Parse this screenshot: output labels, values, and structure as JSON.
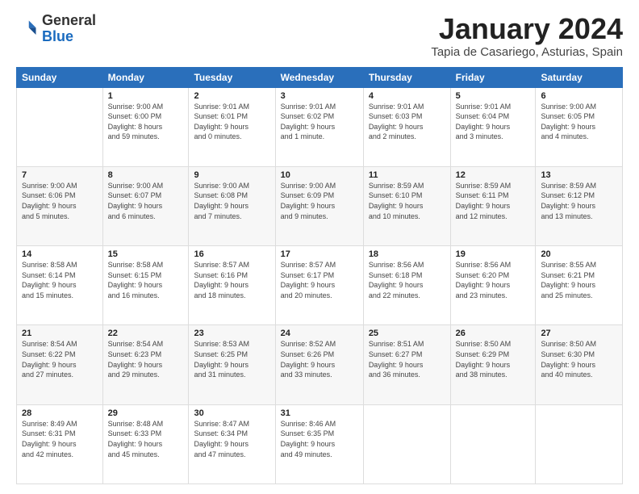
{
  "logo": {
    "general": "General",
    "blue": "Blue"
  },
  "header": {
    "month": "January 2024",
    "location": "Tapia de Casariego, Asturias, Spain"
  },
  "weekdays": [
    "Sunday",
    "Monday",
    "Tuesday",
    "Wednesday",
    "Thursday",
    "Friday",
    "Saturday"
  ],
  "weeks": [
    [
      {
        "day": "",
        "info": ""
      },
      {
        "day": "1",
        "info": "Sunrise: 9:00 AM\nSunset: 6:00 PM\nDaylight: 8 hours\nand 59 minutes."
      },
      {
        "day": "2",
        "info": "Sunrise: 9:01 AM\nSunset: 6:01 PM\nDaylight: 9 hours\nand 0 minutes."
      },
      {
        "day": "3",
        "info": "Sunrise: 9:01 AM\nSunset: 6:02 PM\nDaylight: 9 hours\nand 1 minute."
      },
      {
        "day": "4",
        "info": "Sunrise: 9:01 AM\nSunset: 6:03 PM\nDaylight: 9 hours\nand 2 minutes."
      },
      {
        "day": "5",
        "info": "Sunrise: 9:01 AM\nSunset: 6:04 PM\nDaylight: 9 hours\nand 3 minutes."
      },
      {
        "day": "6",
        "info": "Sunrise: 9:00 AM\nSunset: 6:05 PM\nDaylight: 9 hours\nand 4 minutes."
      }
    ],
    [
      {
        "day": "7",
        "info": "Sunrise: 9:00 AM\nSunset: 6:06 PM\nDaylight: 9 hours\nand 5 minutes."
      },
      {
        "day": "8",
        "info": "Sunrise: 9:00 AM\nSunset: 6:07 PM\nDaylight: 9 hours\nand 6 minutes."
      },
      {
        "day": "9",
        "info": "Sunrise: 9:00 AM\nSunset: 6:08 PM\nDaylight: 9 hours\nand 7 minutes."
      },
      {
        "day": "10",
        "info": "Sunrise: 9:00 AM\nSunset: 6:09 PM\nDaylight: 9 hours\nand 9 minutes."
      },
      {
        "day": "11",
        "info": "Sunrise: 8:59 AM\nSunset: 6:10 PM\nDaylight: 9 hours\nand 10 minutes."
      },
      {
        "day": "12",
        "info": "Sunrise: 8:59 AM\nSunset: 6:11 PM\nDaylight: 9 hours\nand 12 minutes."
      },
      {
        "day": "13",
        "info": "Sunrise: 8:59 AM\nSunset: 6:12 PM\nDaylight: 9 hours\nand 13 minutes."
      }
    ],
    [
      {
        "day": "14",
        "info": "Sunrise: 8:58 AM\nSunset: 6:14 PM\nDaylight: 9 hours\nand 15 minutes."
      },
      {
        "day": "15",
        "info": "Sunrise: 8:58 AM\nSunset: 6:15 PM\nDaylight: 9 hours\nand 16 minutes."
      },
      {
        "day": "16",
        "info": "Sunrise: 8:57 AM\nSunset: 6:16 PM\nDaylight: 9 hours\nand 18 minutes."
      },
      {
        "day": "17",
        "info": "Sunrise: 8:57 AM\nSunset: 6:17 PM\nDaylight: 9 hours\nand 20 minutes."
      },
      {
        "day": "18",
        "info": "Sunrise: 8:56 AM\nSunset: 6:18 PM\nDaylight: 9 hours\nand 22 minutes."
      },
      {
        "day": "19",
        "info": "Sunrise: 8:56 AM\nSunset: 6:20 PM\nDaylight: 9 hours\nand 23 minutes."
      },
      {
        "day": "20",
        "info": "Sunrise: 8:55 AM\nSunset: 6:21 PM\nDaylight: 9 hours\nand 25 minutes."
      }
    ],
    [
      {
        "day": "21",
        "info": "Sunrise: 8:54 AM\nSunset: 6:22 PM\nDaylight: 9 hours\nand 27 minutes."
      },
      {
        "day": "22",
        "info": "Sunrise: 8:54 AM\nSunset: 6:23 PM\nDaylight: 9 hours\nand 29 minutes."
      },
      {
        "day": "23",
        "info": "Sunrise: 8:53 AM\nSunset: 6:25 PM\nDaylight: 9 hours\nand 31 minutes."
      },
      {
        "day": "24",
        "info": "Sunrise: 8:52 AM\nSunset: 6:26 PM\nDaylight: 9 hours\nand 33 minutes."
      },
      {
        "day": "25",
        "info": "Sunrise: 8:51 AM\nSunset: 6:27 PM\nDaylight: 9 hours\nand 36 minutes."
      },
      {
        "day": "26",
        "info": "Sunrise: 8:50 AM\nSunset: 6:29 PM\nDaylight: 9 hours\nand 38 minutes."
      },
      {
        "day": "27",
        "info": "Sunrise: 8:50 AM\nSunset: 6:30 PM\nDaylight: 9 hours\nand 40 minutes."
      }
    ],
    [
      {
        "day": "28",
        "info": "Sunrise: 8:49 AM\nSunset: 6:31 PM\nDaylight: 9 hours\nand 42 minutes."
      },
      {
        "day": "29",
        "info": "Sunrise: 8:48 AM\nSunset: 6:33 PM\nDaylight: 9 hours\nand 45 minutes."
      },
      {
        "day": "30",
        "info": "Sunrise: 8:47 AM\nSunset: 6:34 PM\nDaylight: 9 hours\nand 47 minutes."
      },
      {
        "day": "31",
        "info": "Sunrise: 8:46 AM\nSunset: 6:35 PM\nDaylight: 9 hours\nand 49 minutes."
      },
      {
        "day": "",
        "info": ""
      },
      {
        "day": "",
        "info": ""
      },
      {
        "day": "",
        "info": ""
      }
    ]
  ]
}
